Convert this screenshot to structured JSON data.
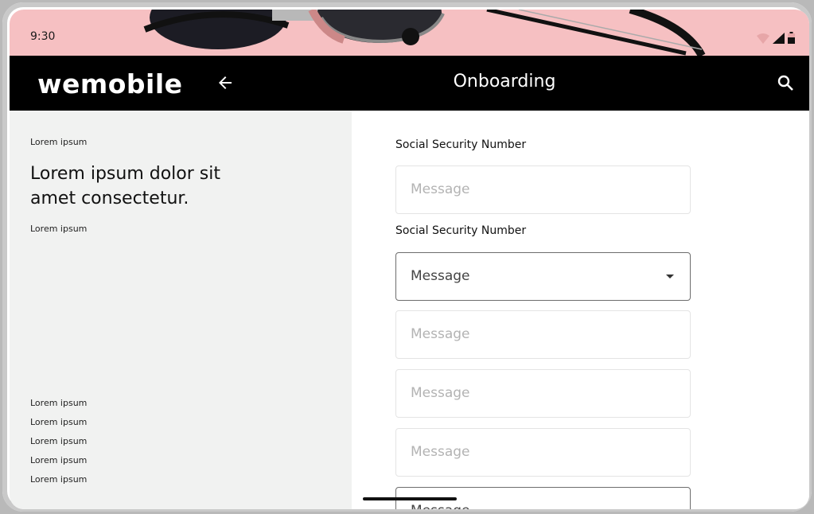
{
  "status_bar": {
    "time": "9:30"
  },
  "app_bar": {
    "logo": "wemobile",
    "title": "Onboarding"
  },
  "left_panel": {
    "overline": "Lorem ipsum",
    "headline": "Lorem ipsum dolor sit amet consectetur.",
    "caption": "Lorem ipsum",
    "links": [
      "Lorem ipsum",
      "Lorem ipsum",
      "Lorem ipsum",
      "Lorem ipsum",
      "Lorem ipsum"
    ]
  },
  "form": {
    "label_1": "Social Security Number",
    "field_1_placeholder": "Message",
    "label_2": "Social Security Number",
    "select_value": "Message",
    "field_3_placeholder": "Message",
    "field_4_placeholder": "Message",
    "field_5_placeholder": "Message",
    "field_6_placeholder": "Message"
  },
  "colors": {
    "appbar": "#000000",
    "status_bg": "#f6c0c2",
    "left_bg": "#f1f2f1"
  }
}
